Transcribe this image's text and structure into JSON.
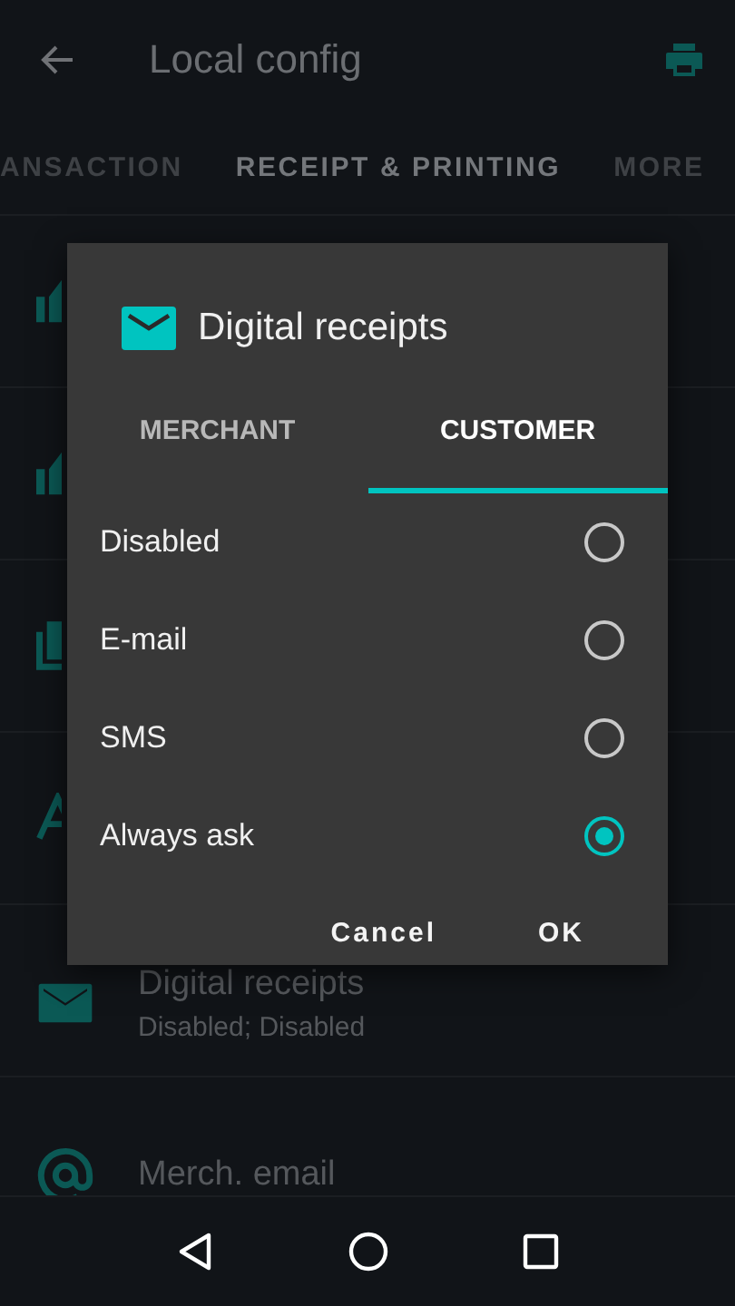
{
  "app_bar": {
    "title": "Local config"
  },
  "tabs": [
    {
      "label": "ANSACTION",
      "selected": false
    },
    {
      "label": "RECEIPT & PRINTING",
      "selected": true
    },
    {
      "label": "MORE",
      "selected": false
    }
  ],
  "settings": [
    {
      "title": "Digital receipts",
      "subtitle": "Disabled; Disabled"
    },
    {
      "title": "Merch. email"
    }
  ],
  "dialog": {
    "title": "Digital receipts",
    "tabs": [
      {
        "label": "MERCHANT",
        "selected": false
      },
      {
        "label": "CUSTOMER",
        "selected": true
      }
    ],
    "options": [
      {
        "label": "Disabled",
        "selected": false
      },
      {
        "label": "E-mail",
        "selected": false
      },
      {
        "label": "SMS",
        "selected": false
      },
      {
        "label": "Always ask",
        "selected": true
      }
    ],
    "buttons": [
      "Cancel",
      "OK"
    ]
  }
}
